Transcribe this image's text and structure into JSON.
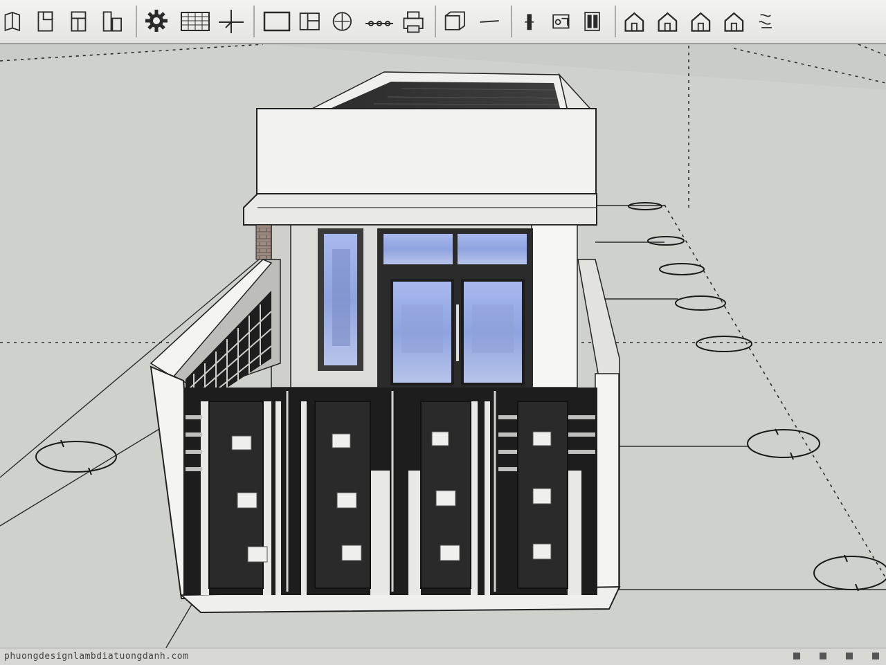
{
  "app": {
    "accent": "#1f1f1f",
    "ground_color": "#c9ccc7"
  },
  "toolbar": {
    "tools": [
      {
        "name": "front-view-tool",
        "icon": "front-view-icon"
      },
      {
        "name": "wall-tool",
        "icon": "wall-icon"
      },
      {
        "name": "door-tool",
        "icon": "door-icon"
      },
      {
        "name": "window-tool",
        "icon": "window-icon"
      },
      {
        "name": "settings-tool",
        "icon": "gear-icon"
      },
      {
        "name": "spreadsheet-tool",
        "icon": "table-icon"
      },
      {
        "name": "axes-tool",
        "icon": "axes-icon"
      },
      {
        "name": "rectangle-tool",
        "icon": "rectangle-icon"
      },
      {
        "name": "panel-tool",
        "icon": "panel-icon"
      },
      {
        "name": "circle-tool",
        "icon": "circle-icon"
      },
      {
        "name": "dimension-tool",
        "icon": "dimension-icon"
      },
      {
        "name": "print-tool",
        "icon": "printer-icon"
      },
      {
        "name": "layers-tool",
        "icon": "layers-icon"
      },
      {
        "name": "line-tool",
        "icon": "line-icon"
      },
      {
        "name": "column-tool",
        "icon": "column-icon"
      },
      {
        "name": "component-tool",
        "icon": "component-icon"
      },
      {
        "name": "door-panel-tool",
        "icon": "door-panel-icon"
      },
      {
        "name": "house-1-tool",
        "icon": "house-icon"
      },
      {
        "name": "house-2-tool",
        "icon": "house-icon"
      },
      {
        "name": "house-3-tool",
        "icon": "house-icon"
      },
      {
        "name": "house-4-tool",
        "icon": "house-icon"
      },
      {
        "name": "extension-tool",
        "icon": "extension-icon"
      }
    ]
  },
  "status": {
    "text": "phuongdesignlambdiatuongdanh.com"
  }
}
